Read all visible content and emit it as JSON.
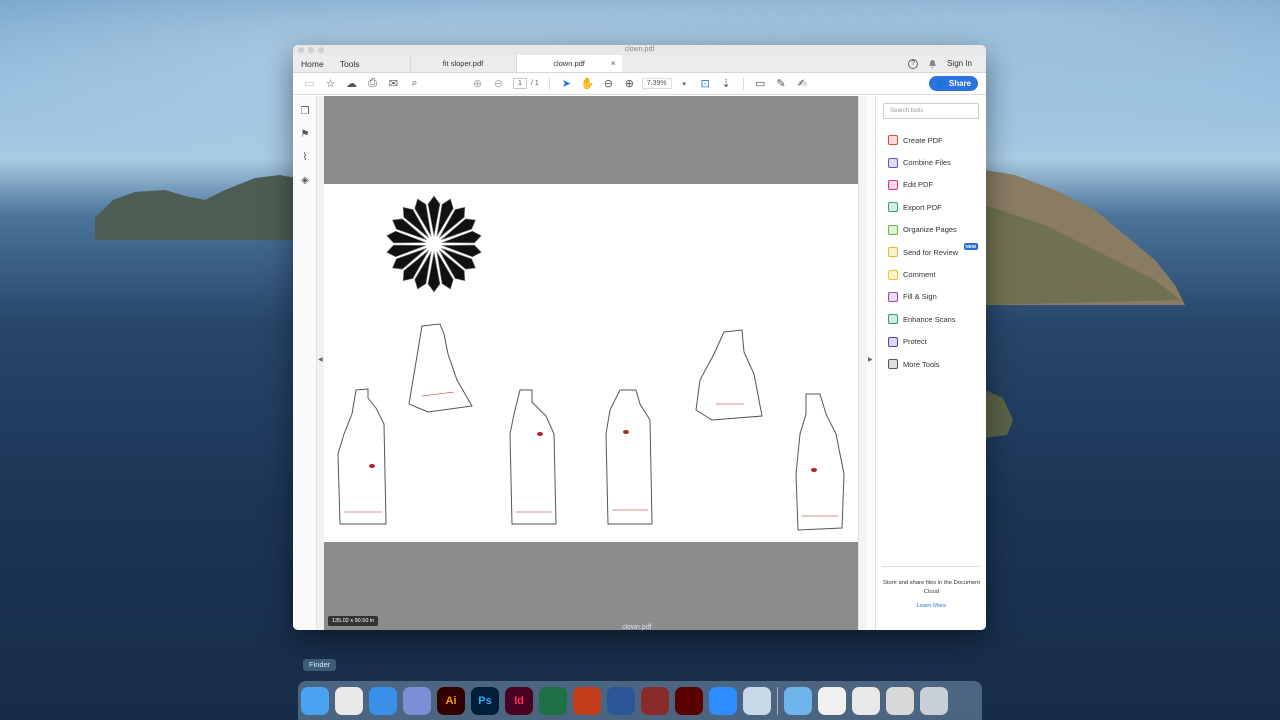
{
  "window": {
    "title": "clown.pdf",
    "nav": [
      "Home",
      "Tools"
    ],
    "tabs": [
      {
        "label": "fit sloper.pdf",
        "active": false
      },
      {
        "label": "clown.pdf",
        "active": true
      }
    ],
    "help_icon": "?",
    "sign_in": "Sign In"
  },
  "toolbar": {
    "page_current": "1",
    "page_total": "/ 1",
    "zoom": "7.39%",
    "share_label": "Share"
  },
  "document": {
    "dimensions": "135.02 x 90.50 in"
  },
  "tools_panel": {
    "search_placeholder": "Search tools",
    "items": [
      {
        "label": "Create PDF",
        "color": "#e0464a"
      },
      {
        "label": "Combine Files",
        "color": "#6a4bd1"
      },
      {
        "label": "Edit PDF",
        "color": "#d8368a"
      },
      {
        "label": "Export PDF",
        "color": "#35a36a"
      },
      {
        "label": "Organize Pages",
        "color": "#6db33f"
      },
      {
        "label": "Send for Review",
        "color": "#e7b829",
        "badge": "NEW"
      },
      {
        "label": "Comment",
        "color": "#f3c126"
      },
      {
        "label": "Fill & Sign",
        "color": "#9a46c8"
      },
      {
        "label": "Enhance Scans",
        "color": "#2aa063"
      },
      {
        "label": "Protect",
        "color": "#4f46b8"
      },
      {
        "label": "More Tools",
        "color": "#555555"
      }
    ],
    "cloud_text": "Store and share files in the Document Cloud",
    "learn_more": "Learn More"
  },
  "dock": {
    "tooltip": "Finder",
    "ghost_title": "clown.pdf",
    "apps": [
      {
        "name": "finder",
        "label": "",
        "color": "#4aa3f0"
      },
      {
        "name": "chrome",
        "label": "",
        "color": "#e8e8e8"
      },
      {
        "name": "safari",
        "label": "",
        "color": "#3a8fe8"
      },
      {
        "name": "creative-cloud",
        "label": "",
        "color": "#7b8fd8"
      },
      {
        "name": "illustrator",
        "label": "Ai",
        "color": "#330000"
      },
      {
        "name": "photoshop",
        "label": "Ps",
        "color": "#001e36"
      },
      {
        "name": "indesign",
        "label": "Id",
        "color": "#49021f"
      },
      {
        "name": "excel",
        "label": "",
        "color": "#1e7145"
      },
      {
        "name": "powerpoint",
        "label": "",
        "color": "#c43e1c"
      },
      {
        "name": "word",
        "label": "",
        "color": "#2b579a"
      },
      {
        "name": "photo-booth",
        "label": "",
        "color": "#8a2b2b"
      },
      {
        "name": "acrobat",
        "label": "",
        "color": "#5a0000"
      },
      {
        "name": "zoom",
        "label": "",
        "color": "#2d8cff"
      },
      {
        "name": "preview",
        "label": "",
        "color": "#c8d8e8"
      },
      {
        "name": "downloads-folder",
        "label": "",
        "color": "#6fb4ea"
      },
      {
        "name": "document-stack",
        "label": "",
        "color": "#f0f0f0"
      },
      {
        "name": "screenshot-stack",
        "label": "",
        "color": "#e8e8e8"
      },
      {
        "name": "window-stack",
        "label": "",
        "color": "#d8d8d8"
      },
      {
        "name": "trash",
        "label": "",
        "color": "#c9cfd6"
      }
    ]
  }
}
